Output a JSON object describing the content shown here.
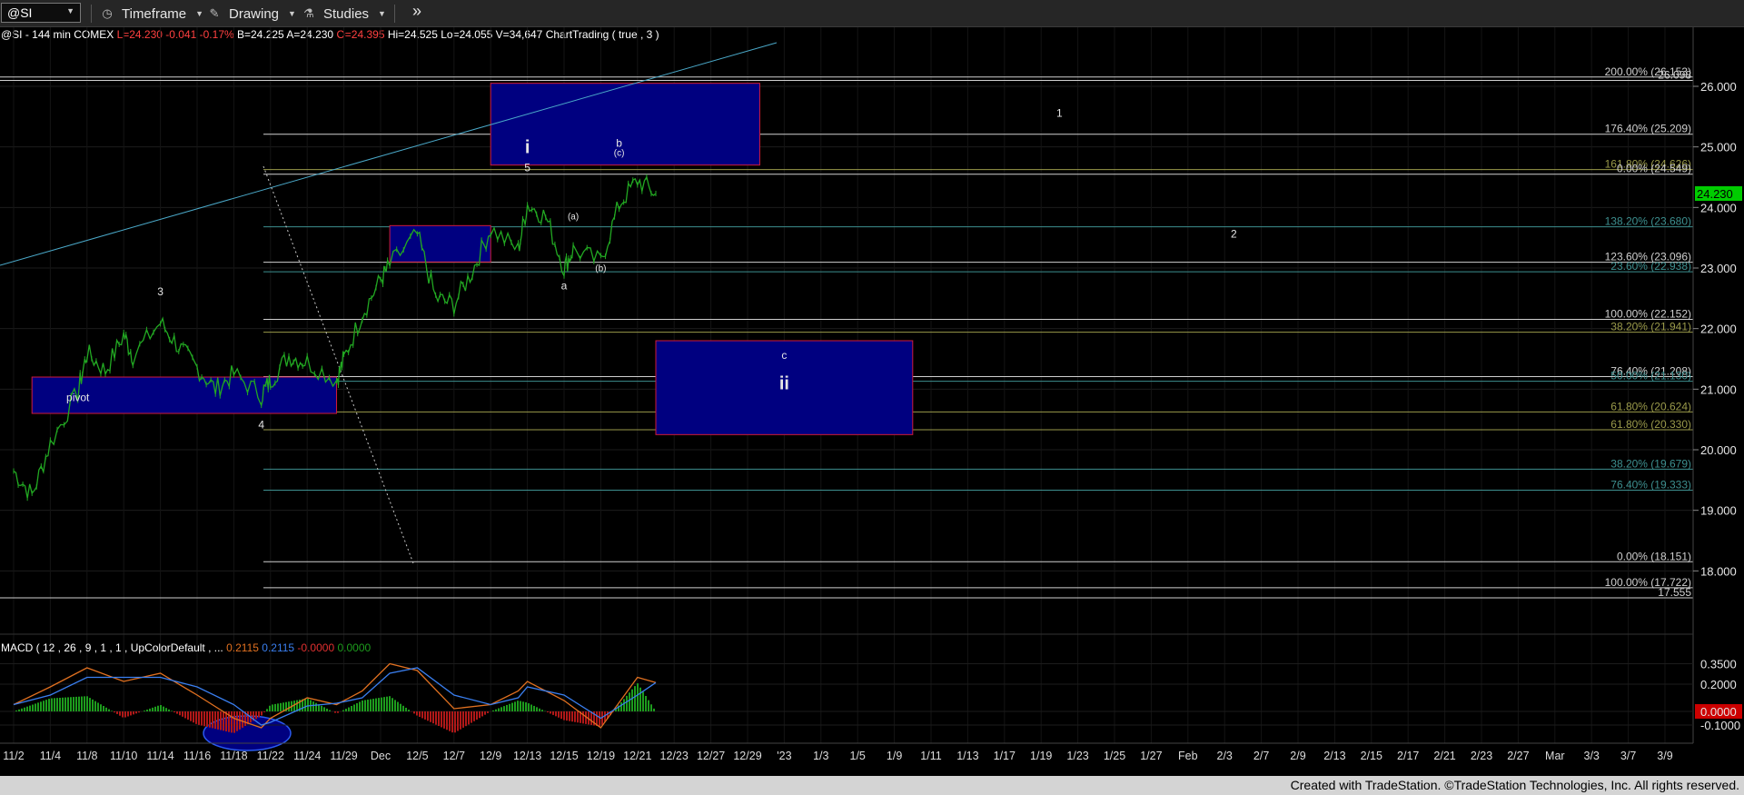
{
  "toolbar": {
    "symbol": "@SI",
    "timeframe_label": "Timeframe",
    "drawing_label": "Drawing",
    "studies_label": "Studies",
    "more_label": "»"
  },
  "header": {
    "symbol": "@SI - 144 min",
    "exchange": "COMEX",
    "last": "L=24.230",
    "change": "-0.041",
    "change_pct": "-0.17%",
    "bid": "B=24.225",
    "ask": "A=24.230",
    "open": "O=24.395",
    "high": "Hi=24.525",
    "low": "Lo=24.055",
    "volume": "V=34,647",
    "study": "ChartTrading ( true , 3 )"
  },
  "colors": {
    "price_bars": "#22a822",
    "fib_white": "#cfcfcf",
    "fib_olive": "#9a9a4a",
    "fib_teal": "#3d8f8f",
    "box_fill": "#000080",
    "box_border": "#d01a3a",
    "trendline": "#4aa8c8",
    "macd_line": "#e07020",
    "signal_line": "#3a7ff0",
    "hist_pos": "#1d9c1d",
    "hist_neg": "#b01818"
  },
  "chart_data": [
    {
      "type": "line",
      "title": "@SI - 144 min",
      "ylim": [
        17.3,
        26.9
      ],
      "x_dates": [
        "11/2",
        "11/4",
        "11/8",
        "11/10",
        "11/14",
        "11/16",
        "11/18",
        "11/22",
        "11/24",
        "11/29",
        "Dec",
        "12/5",
        "12/7",
        "12/9",
        "12/13",
        "12/15",
        "12/19",
        "12/21",
        "12/23",
        "12/27",
        "12/29",
        "'23",
        "1/3",
        "1/5",
        "1/9",
        "1/11",
        "1/13",
        "1/17",
        "1/19",
        "1/23",
        "1/25",
        "1/27",
        "Feb",
        "2/3",
        "2/7",
        "2/9",
        "2/13",
        "2/15",
        "2/17",
        "2/21",
        "2/23",
        "2/27",
        "Mar",
        "3/3",
        "3/7",
        "3/9"
      ],
      "price_axis_ticks": [
        "26.000",
        "25.000",
        "24.000",
        "23.000",
        "22.000",
        "21.000",
        "20.000",
        "19.000",
        "18.000"
      ],
      "last_price": "24.230",
      "last_price_value": 24.23,
      "close_path": [
        [
          "11/2",
          19.65
        ],
        [
          "11/3",
          19.25
        ],
        [
          "11/4",
          20.1
        ],
        [
          "11/7",
          20.95
        ],
        [
          "11/8",
          21.6
        ],
        [
          "11/9",
          21.3
        ],
        [
          "11/10",
          21.9
        ],
        [
          "11/11",
          21.55
        ],
        [
          "11/14",
          22.1
        ],
        [
          "11/15",
          21.7
        ],
        [
          "11/16",
          21.35
        ],
        [
          "11/17",
          21.0
        ],
        [
          "11/18",
          21.25
        ],
        [
          "11/21",
          20.9
        ],
        [
          "11/22",
          21.15
        ],
        [
          "11/23",
          21.55
        ],
        [
          "11/24",
          21.45
        ],
        [
          "11/28",
          21.15
        ],
        [
          "11/29",
          21.5
        ],
        [
          "11/30",
          22.25
        ],
        [
          "12/1",
          22.8
        ],
        [
          "12/2",
          23.05
        ],
        [
          "12/5",
          23.55
        ],
        [
          "12/6",
          22.5
        ],
        [
          "12/7",
          22.4
        ],
        [
          "12/8",
          22.95
        ],
        [
          "12/9",
          23.65
        ],
        [
          "12/12",
          23.3
        ],
        [
          "12/13",
          24.05
        ],
        [
          "12/14",
          23.85
        ],
        [
          "12/15",
          23.0
        ],
        [
          "12/16",
          23.3
        ],
        [
          "12/19",
          23.1
        ],
        [
          "12/20",
          24.05
        ],
        [
          "12/21",
          24.45
        ],
        [
          "12/22",
          24.23
        ]
      ],
      "fib_levels": [
        {
          "label": "200.00% (26.153)",
          "value": 26.153,
          "color": "white"
        },
        {
          "label": "26.098",
          "value": 26.098,
          "color": "white"
        },
        {
          "label": "176.40% (25.209)",
          "value": 25.209,
          "color": "white"
        },
        {
          "label": "161.80% (24.626)",
          "value": 24.626,
          "color": "olive"
        },
        {
          "label": "0.00% (24.549)",
          "value": 24.549,
          "color": "white"
        },
        {
          "label": "138.20% (23.680)",
          "value": 23.68,
          "color": "teal"
        },
        {
          "label": "123.60% (23.096)",
          "value": 23.096,
          "color": "white"
        },
        {
          "label": "23.60% (22.938)",
          "value": 22.938,
          "color": "teal"
        },
        {
          "label": "100.00% (22.152)",
          "value": 22.152,
          "color": "white"
        },
        {
          "label": "38.20% (21.941)",
          "value": 21.941,
          "color": "olive"
        },
        {
          "label": "76.40% (21.208)",
          "value": 21.208,
          "color": "white"
        },
        {
          "label": "50.00% (21.130)",
          "value": 21.13,
          "color": "teal"
        },
        {
          "label": "61.80% (20.624)",
          "value": 20.624,
          "color": "olive"
        },
        {
          "label": "61.80% (20.330)",
          "value": 20.33,
          "color": "olive"
        },
        {
          "label": "38.20% (19.679)",
          "value": 19.679,
          "color": "teal"
        },
        {
          "label": "76.40% (19.333)",
          "value": 19.333,
          "color": "teal"
        },
        {
          "label": "0.00% (18.151)",
          "value": 18.151,
          "color": "white"
        },
        {
          "label": "100.00% (17.722)",
          "value": 17.722,
          "color": "white"
        },
        {
          "label": "17.555",
          "value": 17.555,
          "color": "white"
        }
      ],
      "zones": [
        {
          "from": "11/3",
          "to": "11/28",
          "low": 20.6,
          "high": 21.2,
          "label": "pivot"
        },
        {
          "from": "12/2",
          "to": "12/9",
          "low": 23.1,
          "high": 23.7,
          "label": ""
        },
        {
          "from": "12/9",
          "to": "12/30",
          "low": 24.7,
          "high": 26.05,
          "label": ""
        },
        {
          "from": "12/22",
          "to": "1/10",
          "low": 20.25,
          "high": 21.8,
          "label": ""
        }
      ],
      "wave_labels": [
        {
          "text": "3",
          "date": "11/14",
          "price": 22.55
        },
        {
          "text": "4",
          "date": "11/21",
          "price": 20.35
        },
        {
          "text": "pivot",
          "date": "11/7",
          "price": 20.8
        },
        {
          "text": "5",
          "date": "12/13",
          "price": 24.6
        },
        {
          "text": "i",
          "date": "12/13",
          "price": 24.9
        },
        {
          "text": "a",
          "date": "12/15",
          "price": 22.65
        },
        {
          "text": "(a)",
          "date": "12/16",
          "price": 23.8
        },
        {
          "text": "(b)",
          "date": "12/19",
          "price": 22.95
        },
        {
          "text": "b",
          "date": "12/20",
          "price": 25.0
        },
        {
          "text": "(c)",
          "date": "12/20",
          "price": 24.85
        },
        {
          "text": "c",
          "date": "1/1",
          "price": 21.5
        },
        {
          "text": "ii",
          "date": "1/1",
          "price": 21.0
        },
        {
          "text": "1",
          "date": "1/21",
          "price": 25.5
        },
        {
          "text": "2",
          "date": "2/4",
          "price": 23.5
        }
      ]
    },
    {
      "type": "line",
      "title": "MACD ( 12 , 26 , 9 , 1 , 1 , UpColorDefault , ...",
      "legend_values": [
        "0.2115",
        "0.2115",
        "-0.0000",
        "0.0000"
      ],
      "axis_ticks": [
        "0.3500",
        "0.2000",
        "0.0000",
        "-0.1000"
      ],
      "axis_tick_values": [
        0.35,
        0.2,
        0.0,
        -0.1
      ],
      "ylim": [
        -0.22,
        0.42
      ],
      "series": [
        {
          "name": "MACD",
          "values": [
            [
              "11/2",
              0.05
            ],
            [
              "11/4",
              0.18
            ],
            [
              "11/8",
              0.32
            ],
            [
              "11/10",
              0.22
            ],
            [
              "11/14",
              0.28
            ],
            [
              "11/16",
              0.12
            ],
            [
              "11/18",
              -0.05
            ],
            [
              "11/21",
              -0.12
            ],
            [
              "11/22",
              -0.05
            ],
            [
              "11/24",
              0.1
            ],
            [
              "11/28",
              0.05
            ],
            [
              "11/30",
              0.15
            ],
            [
              "12/2",
              0.35
            ],
            [
              "12/5",
              0.3
            ],
            [
              "12/7",
              0.02
            ],
            [
              "12/9",
              0.05
            ],
            [
              "12/12",
              0.15
            ],
            [
              "12/13",
              0.22
            ],
            [
              "12/15",
              0.08
            ],
            [
              "12/19",
              -0.12
            ],
            [
              "12/21",
              0.25
            ],
            [
              "12/22",
              0.2115
            ]
          ]
        },
        {
          "name": "Signal",
          "values": [
            [
              "11/2",
              0.05
            ],
            [
              "11/4",
              0.12
            ],
            [
              "11/8",
              0.25
            ],
            [
              "11/10",
              0.25
            ],
            [
              "11/14",
              0.25
            ],
            [
              "11/16",
              0.18
            ],
            [
              "11/18",
              0.05
            ],
            [
              "11/21",
              -0.1
            ],
            [
              "11/22",
              -0.08
            ],
            [
              "11/24",
              0.04
            ],
            [
              "11/28",
              0.06
            ],
            [
              "11/30",
              0.1
            ],
            [
              "12/2",
              0.28
            ],
            [
              "12/5",
              0.32
            ],
            [
              "12/7",
              0.12
            ],
            [
              "12/9",
              0.05
            ],
            [
              "12/12",
              0.1
            ],
            [
              "12/13",
              0.18
            ],
            [
              "12/15",
              0.12
            ],
            [
              "12/19",
              -0.05
            ],
            [
              "12/21",
              0.12
            ],
            [
              "12/22",
              0.2115
            ]
          ]
        }
      ]
    }
  ],
  "footer": {
    "credit": "Created with TradeStation. ©TradeStation Technologies, Inc. All rights reserved."
  }
}
